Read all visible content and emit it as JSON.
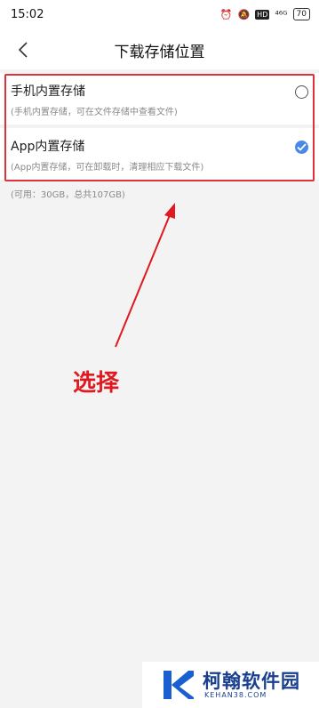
{
  "status_bar": {
    "time": "15:02",
    "signal": "⁴⁶ᴳ",
    "battery": "70"
  },
  "header": {
    "title": "下载存储位置"
  },
  "options": [
    {
      "title": "手机内置存储",
      "description": "(手机内置存储，可在文件存储中查看文件)",
      "selected": false
    },
    {
      "title": "App内置存储",
      "description": "(App内置存储，可在卸载时，清理相应下载文件)",
      "selected": true
    }
  ],
  "storage_info": "(可用：30GB，总共107GB)",
  "annotation": {
    "label": "选择",
    "color": "#e01820"
  },
  "watermark": {
    "name": "柯翰软件园",
    "url": "KEHAN38.COM"
  },
  "colors": {
    "accent": "#4a88e8",
    "highlight": "#e0303a"
  }
}
